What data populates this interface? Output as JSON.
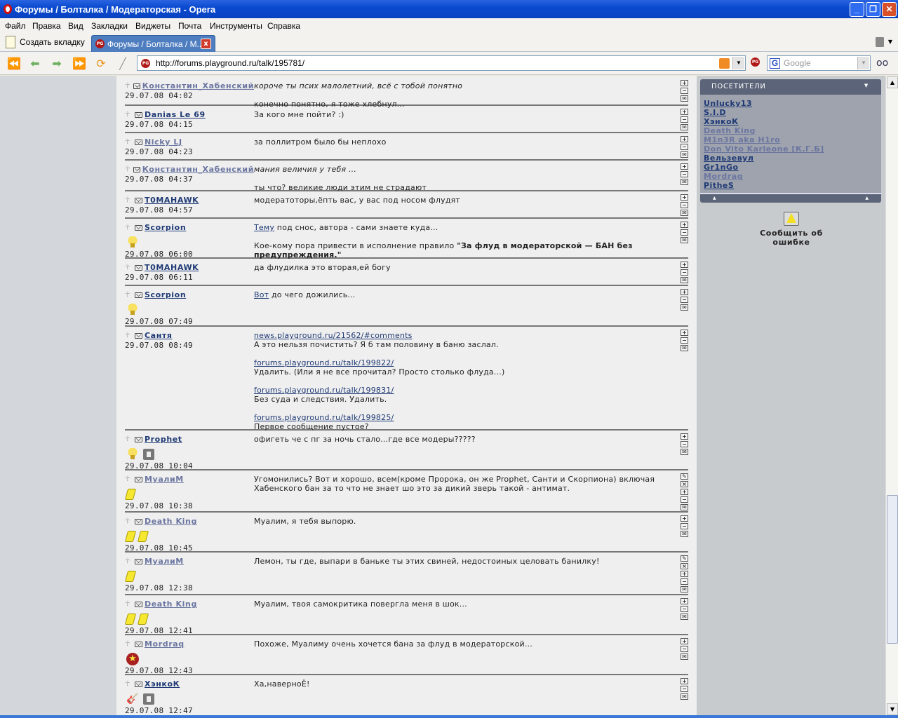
{
  "window": {
    "title": "Форумы / Болталка / Модераторская - Opera"
  },
  "menu": [
    "Файл",
    "Правка",
    "Вид",
    "Закладки",
    "Виджеты",
    "Почта",
    "Инструменты",
    "Справка"
  ],
  "tabs": {
    "new_tab": "Создать вкладку",
    "active": "Форумы / Болталка / М..."
  },
  "address": {
    "url": "http://forums.playground.ru/talk/195781/",
    "search_placeholder": "Google"
  },
  "colors": {
    "active_user": "#1f3a75",
    "inactive_user": "#6b76a0",
    "content_bg": "#efefef",
    "sidebar_bg": "#c8cbce",
    "panel_header": "#5b6478"
  },
  "posts": [
    {
      "user": "Константин_Хабенский",
      "online": false,
      "date": "29.07.08 04:02",
      "badges": [],
      "actions": [
        "plus",
        "minus",
        "mail"
      ],
      "lines": [
        [
          {
            "i": "короче ты псих малолетний, всё с тобой понятно"
          }
        ],
        [],
        [
          {
            "t": "конечно понятно, я тоже хлебнул..."
          }
        ]
      ]
    },
    {
      "user": "Danias Le 69",
      "online": true,
      "date": "29.07.08 04:15",
      "badges": [],
      "actions": [
        "plus",
        "minus",
        "mail"
      ],
      "lines": [
        [
          {
            "t": "За кого мне пойти? :)"
          }
        ]
      ]
    },
    {
      "user": "Nicky LJ",
      "online": false,
      "date": "29.07.08 04:23",
      "badges": [],
      "actions": [
        "plus",
        "minus",
        "mail"
      ],
      "lines": [
        [
          {
            "t": "за поллитром было бы неплохо"
          }
        ]
      ]
    },
    {
      "user": "Константин_Хабенский",
      "online": false,
      "date": "29.07.08 04:37",
      "badges": [],
      "actions": [
        "plus",
        "minus",
        "mail"
      ],
      "lines": [
        [
          {
            "i": "мания величия у тебя ..."
          }
        ],
        [],
        [
          {
            "t": "ты что? великие люди этим не страдают"
          }
        ]
      ]
    },
    {
      "user": "T0MAHAWK",
      "online": true,
      "date": "29.07.08 04:57",
      "badges": [],
      "actions": [
        "plus",
        "minus",
        "mail"
      ],
      "lines": [
        [
          {
            "t": "модератоторы,ёпть вас, у вас под носом флудят"
          }
        ]
      ]
    },
    {
      "user": "Scorpion",
      "online": true,
      "date": "29.07.08 06:00",
      "badges": [
        "trophy"
      ],
      "actions": [
        "plus",
        "minus",
        "mail"
      ],
      "lines": [
        [
          {
            "a": "Тему"
          },
          {
            "t": " под снос, автора - сами знаете куда..."
          }
        ],
        [],
        [
          {
            "t": "Кое-кому пора привести в исполнение правило "
          },
          {
            "b": "\"За флуд в модераторской — БАН без предупреждения.\""
          }
        ]
      ]
    },
    {
      "user": "T0MAHAWK",
      "online": true,
      "date": "29.07.08 06:11",
      "badges": [],
      "actions": [
        "plus",
        "minus",
        "mail"
      ],
      "lines": [
        [
          {
            "t": "да флудилка это вторая,ей богу"
          }
        ]
      ]
    },
    {
      "user": "Scorpion",
      "online": true,
      "date": "29.07.08 07:49",
      "badges": [
        "trophy"
      ],
      "actions": [
        "plus",
        "minus",
        "mail"
      ],
      "lines": [
        [
          {
            "a": "Вот"
          },
          {
            "t": " до чего дожились..."
          }
        ]
      ]
    },
    {
      "user": "Сантя",
      "online": true,
      "date": "29.07.08 08:49",
      "badges": [],
      "actions": [
        "plus",
        "minus",
        "mail"
      ],
      "lines": [
        [
          {
            "a": "news.playground.ru/21562/#comments"
          }
        ],
        [
          {
            "t": "А это нельзя почистить? Я б там половину в баню заслал."
          }
        ],
        [],
        [
          {
            "a": "forums.playground.ru/talk/199822/"
          }
        ],
        [
          {
            "t": "Удалить. (Или я не все прочитал? Просто столько флуда...)"
          }
        ],
        [],
        [
          {
            "a": "forums.playground.ru/talk/199831/"
          }
        ],
        [
          {
            "t": "Без суда и следствия. Удалить."
          }
        ],
        [],
        [
          {
            "a": "forums.playground.ru/talk/199825/"
          }
        ],
        [
          {
            "t": "Первое сообщение пустое?"
          }
        ]
      ]
    },
    {
      "user": "Prophet",
      "online": true,
      "date": "29.07.08 10:04",
      "badges": [
        "trophy",
        "floppy"
      ],
      "actions": [
        "plus",
        "minus",
        "mail"
      ],
      "lines": [
        [
          {
            "t": "офигеть че с пг за ночь стало...где все модеры?????"
          }
        ]
      ]
    },
    {
      "user": "МуалиМ",
      "online": false,
      "date": "29.07.08 10:38",
      "badges": [
        "card"
      ],
      "actions": [
        "edit",
        "delete",
        "plus",
        "minus",
        "mail"
      ],
      "lines": [
        [
          {
            "t": "Угомонились? Вот и хорошо, всем(кроме Пророка, он же Prophet, Санти и Скорпиона) включая Хабенского бан за то что не знает шо это за дикий зверь такой - антимат."
          }
        ]
      ]
    },
    {
      "user": "Death King",
      "online": false,
      "date": "29.07.08 10:45",
      "badges": [
        "card",
        "card"
      ],
      "actions": [
        "plus",
        "minus",
        "mail"
      ],
      "lines": [
        [
          {
            "t": "Муалим, я тебя выпорю."
          }
        ]
      ]
    },
    {
      "user": "МуалиМ",
      "online": false,
      "date": "29.07.08 12:38",
      "badges": [
        "card"
      ],
      "actions": [
        "edit",
        "delete",
        "plus",
        "minus",
        "mail"
      ],
      "lines": [
        [
          {
            "t": "Лемон, ты где, выпари в баньке ты этих свиней, недостоиных целовать банилку!"
          }
        ]
      ]
    },
    {
      "user": "Death King",
      "online": false,
      "date": "29.07.08 12:41",
      "badges": [
        "card",
        "card"
      ],
      "actions": [
        "plus",
        "minus",
        "mail"
      ],
      "lines": [
        [
          {
            "t": "Муалим, твоя самокритика повергла меня в шок..."
          }
        ]
      ]
    },
    {
      "user": "Mordraq",
      "online": false,
      "date": "29.07.08 12:43",
      "badges": [
        "star"
      ],
      "actions": [
        "plus",
        "minus",
        "mail"
      ],
      "lines": [
        [
          {
            "t": "Похоже, Муалиму очень хочется бана за флуд в модераторской..."
          }
        ]
      ]
    },
    {
      "user": "ХэнкоК",
      "online": true,
      "date": "29.07.08 12:47",
      "badges": [
        "guitar",
        "floppy"
      ],
      "actions": [
        "plus",
        "minus",
        "mail"
      ],
      "lines": [
        [
          {
            "t": "Ха,наверноЁ!"
          }
        ]
      ]
    }
  ],
  "sidebar": {
    "visitors_title": "ПОСЕТИТЕЛИ",
    "visitors": [
      {
        "name": "Unlucky13",
        "online": true
      },
      {
        "name": "S.I.D",
        "online": true
      },
      {
        "name": "ХэнкоК",
        "online": true
      },
      {
        "name": "Death King",
        "online": false
      },
      {
        "name": "M1n3R aka H1ro",
        "online": false
      },
      {
        "name": "Don Vito Karleone [К.Г.Б]",
        "online": false
      },
      {
        "name": "Вельзевул",
        "online": true
      },
      {
        "name": "Gr1nGo",
        "online": true
      },
      {
        "name": "Mordraq",
        "online": false
      },
      {
        "name": "PitheS",
        "online": true
      }
    ],
    "report_label": "Сообщить об ошибке"
  }
}
